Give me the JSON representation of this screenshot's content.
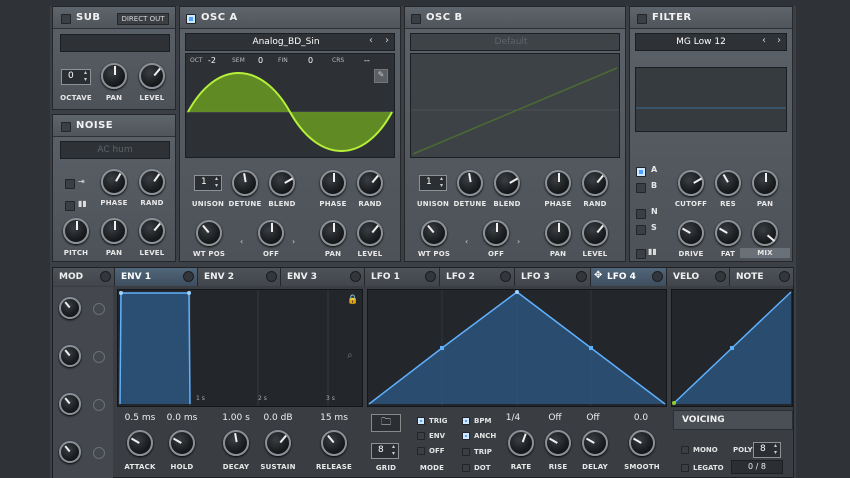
{
  "sub": {
    "title": "SUB",
    "direct_out": "DIRECT OUT",
    "octave_value": "0",
    "labels": [
      "OCTAVE",
      "PAN",
      "LEVEL"
    ]
  },
  "noise": {
    "title": "NOISE",
    "preset": "AC hum",
    "labels_row1": [
      "PHASE",
      "RAND"
    ],
    "labels_row2": [
      "PITCH",
      "PAN",
      "LEVEL"
    ]
  },
  "osc_a": {
    "title": "OSC A",
    "wavetable": "Analog_BD_Sin",
    "oct_label": "OCT",
    "oct_value": "-2",
    "sem_label": "SEM",
    "sem_value": "0",
    "fin_label": "FIN",
    "fin_value": "0",
    "crs_label": "CRS",
    "crs_value": "--",
    "unison_value": "1",
    "labels_row1": [
      "UNISON",
      "DETUNE",
      "BLEND",
      "PHASE",
      "RAND"
    ],
    "labels_row2": [
      "WT POS",
      "OFF",
      "PAN",
      "LEVEL"
    ]
  },
  "osc_b": {
    "title": "OSC B",
    "wavetable": "Default",
    "unison_value": "1",
    "labels_row1": [
      "UNISON",
      "DETUNE",
      "BLEND",
      "PHASE",
      "RAND"
    ],
    "labels_row2": [
      "WT POS",
      "OFF",
      "PAN",
      "LEVEL"
    ]
  },
  "filter": {
    "title": "FILTER",
    "type": "MG Low 12",
    "routes": [
      "A",
      "B",
      "N",
      "S"
    ],
    "labels_row1": [
      "CUTOFF",
      "RES",
      "PAN"
    ],
    "labels_row2": [
      "DRIVE",
      "FAT",
      "MIX"
    ]
  },
  "mod": {
    "title": "MOD"
  },
  "tabs": [
    "ENV 1",
    "ENV 2",
    "ENV 3",
    "LFO 1",
    "LFO 2",
    "LFO 3",
    "LFO 4",
    "VELO",
    "NOTE"
  ],
  "env": {
    "ticks": [
      "1 s",
      "2 s",
      "3 s"
    ],
    "values": [
      "0.5 ms",
      "0.0 ms",
      "1.00 s",
      "0.0 dB",
      "15 ms"
    ],
    "labels": [
      "ATTACK",
      "HOLD",
      "DECAY",
      "SUSTAIN",
      "RELEASE"
    ]
  },
  "lfo": {
    "grid_value": "8",
    "grid_label": "GRID",
    "mode_label": "MODE",
    "modes": [
      "TRIG",
      "ENV",
      "OFF"
    ],
    "options": [
      "BPM",
      "ANCH",
      "TRIP",
      "DOT"
    ],
    "values": [
      "1/4",
      "Off",
      "Off",
      "0.0"
    ],
    "labels": [
      "RATE",
      "RISE",
      "DELAY",
      "SMOOTH"
    ]
  },
  "voicing": {
    "title": "VOICING",
    "mono": "MONO",
    "poly": "POLY",
    "poly_value": "8",
    "legato": "LEGATO",
    "voices": "0 / 8"
  },
  "colors": {
    "accent": "#4aa3ff",
    "wave_green": "#8fd12a",
    "curve_blue": "#4a9be0"
  }
}
